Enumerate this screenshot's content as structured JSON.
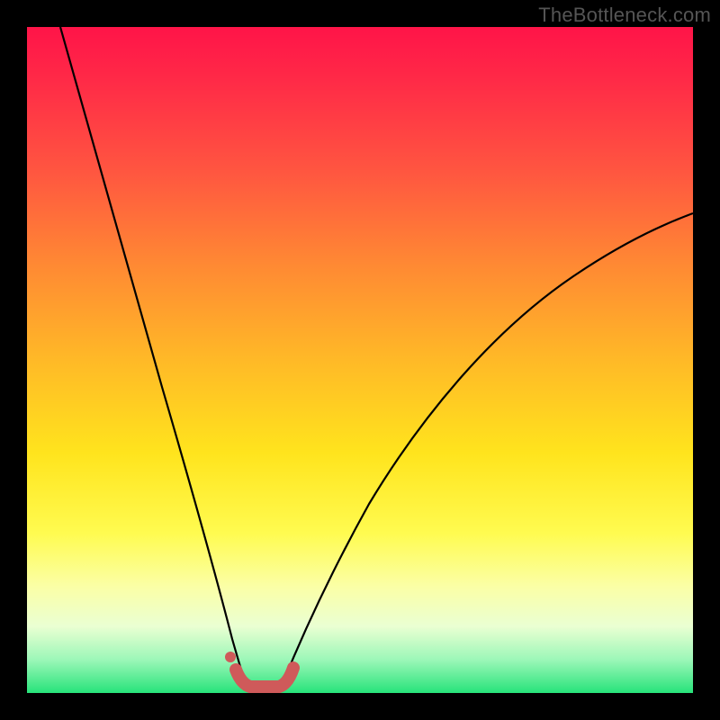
{
  "watermark": "TheBottleneck.com",
  "chart_data": {
    "type": "line",
    "title": "",
    "xlabel": "",
    "ylabel": "",
    "xlim": [
      0,
      100
    ],
    "ylim": [
      0,
      100
    ],
    "grid": false,
    "legend": false,
    "background_gradient": [
      "#ff1448",
      "#ff5740",
      "#ffb927",
      "#fffb50",
      "#eaffd2",
      "#27e37a"
    ],
    "series": [
      {
        "name": "left-curve",
        "x": [
          5,
          8,
          11,
          14,
          17,
          20,
          23,
          26,
          28,
          30,
          31.5,
          32.5
        ],
        "y": [
          100,
          88,
          76,
          64,
          53,
          42,
          32,
          22,
          14,
          7,
          3,
          1
        ]
      },
      {
        "name": "right-curve",
        "x": [
          38,
          40,
          43,
          47,
          52,
          58,
          65,
          73,
          82,
          92,
          100
        ],
        "y": [
          1,
          3,
          8,
          15,
          24,
          33,
          43,
          52,
          60,
          67,
          72
        ]
      },
      {
        "name": "trough-marker",
        "x": [
          31,
          32,
          33,
          34.5,
          36,
          37.5,
          38.5,
          39.5
        ],
        "y": [
          3.5,
          1.5,
          0.8,
          0.6,
          0.6,
          0.8,
          1.6,
          3.2
        ]
      }
    ],
    "annotations": [
      {
        "type": "dot",
        "x": 30.5,
        "y": 5.5,
        "color": "#cf5a5a"
      }
    ]
  }
}
